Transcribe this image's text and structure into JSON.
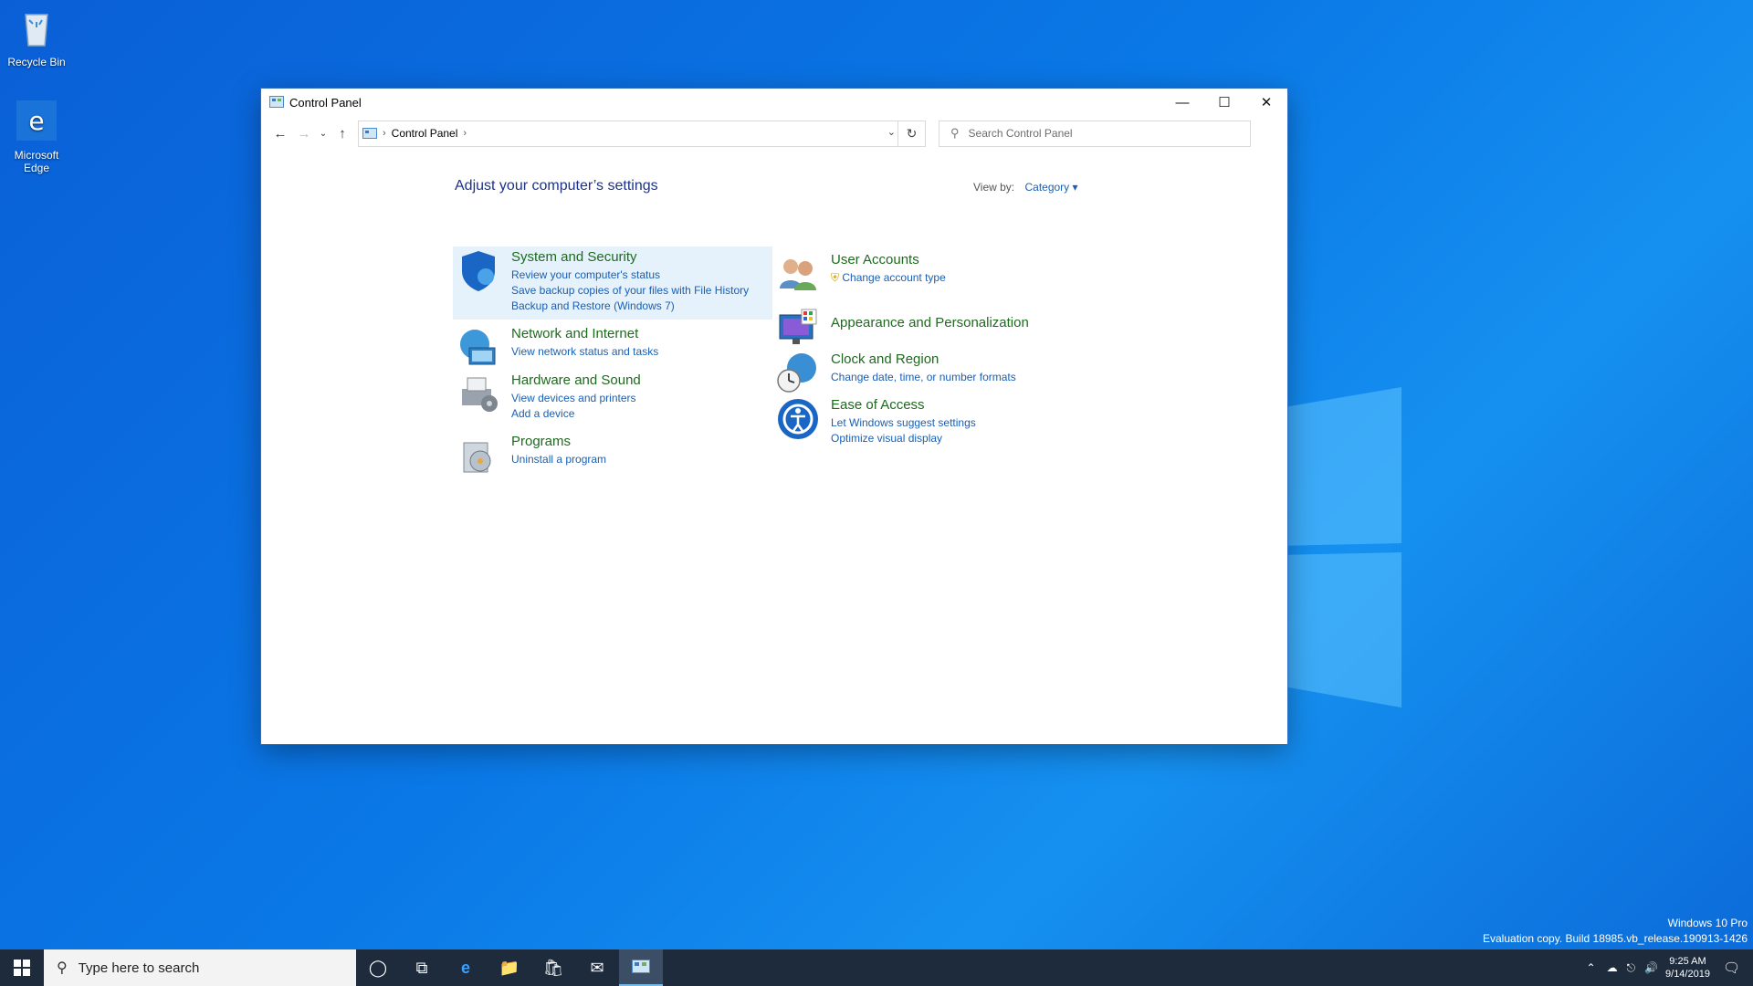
{
  "desktop": {
    "icons": [
      {
        "label": "Recycle Bin"
      },
      {
        "label": "Microsoft Edge"
      }
    ],
    "watermark": {
      "edition": "Windows 10 Pro",
      "build": "Evaluation copy. Build 18985.vb_release.190913-1426"
    }
  },
  "window": {
    "title": "Control Panel",
    "address": {
      "crumb": "Control Panel"
    },
    "search_placeholder": "Search Control Panel",
    "heading": "Adjust your computer’s settings",
    "view_by_label": "View by:",
    "view_by_value": "Category",
    "categories": [
      {
        "title": "System and Security",
        "links": [
          "Review your computer's status",
          "Save backup copies of your files with File History",
          "Backup and Restore (Windows 7)"
        ]
      },
      {
        "title": "Network and Internet",
        "links": [
          "View network status and tasks"
        ]
      },
      {
        "title": "Hardware and Sound",
        "links": [
          "View devices and printers",
          "Add a device"
        ]
      },
      {
        "title": "Programs",
        "links": [
          "Uninstall a program"
        ]
      },
      {
        "title": "User Accounts",
        "links": [
          "Change account type"
        ]
      },
      {
        "title": "Appearance and Personalization",
        "links": []
      },
      {
        "title": "Clock and Region",
        "links": [
          "Change date, time, or number formats"
        ]
      },
      {
        "title": "Ease of Access",
        "links": [
          "Let Windows suggest settings",
          "Optimize visual display"
        ]
      }
    ]
  },
  "taskbar": {
    "search_placeholder": "Type here to search",
    "time": "9:25 AM",
    "date": "9/14/2019"
  },
  "colors": {
    "accent": "#0a78e6",
    "link": "#1a5fb4",
    "category_title": "#1e6a1e"
  }
}
